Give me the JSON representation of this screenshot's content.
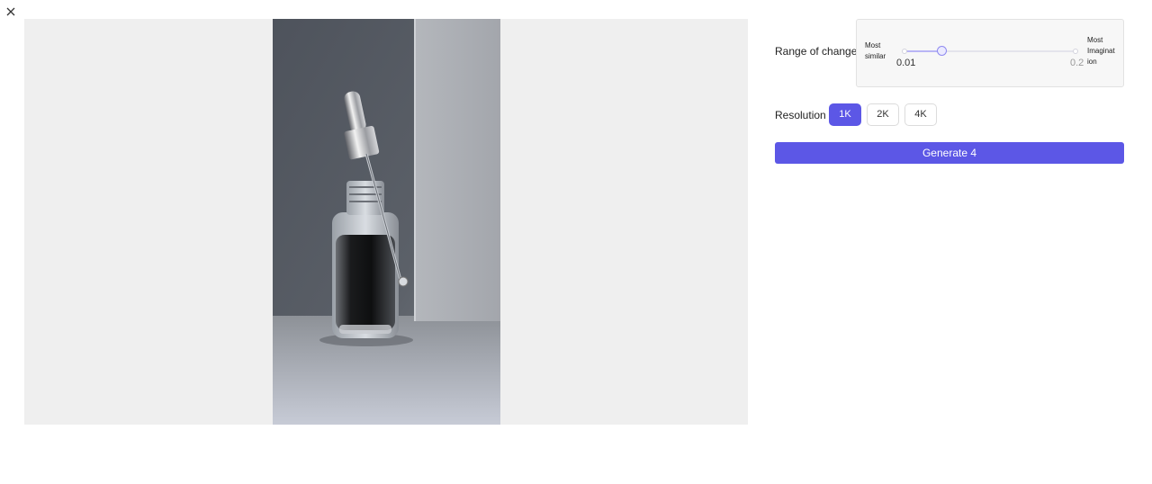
{
  "dialog": {
    "close_icon": "close-icon"
  },
  "preview": {
    "image": "serum dropper bottle product photo"
  },
  "range": {
    "label": "Range of change",
    "left_label": "Most similar",
    "right_label": "Most Imaginat ion",
    "min_value": "0.01",
    "max_value": "0.2",
    "current_fraction": 0.22
  },
  "resolution": {
    "label": "Resolution :",
    "options": [
      "1K",
      "2K",
      "4K"
    ],
    "selected": "1K"
  },
  "generate": {
    "label": "Generate 4"
  },
  "colors": {
    "accent": "#5c57e6",
    "preview_bg": "#efefef"
  }
}
